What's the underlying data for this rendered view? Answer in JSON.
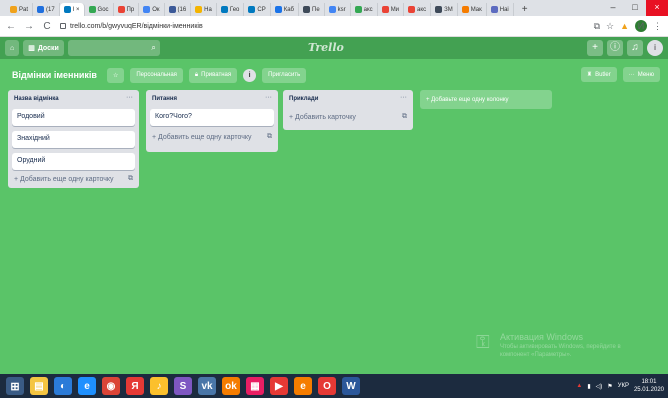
{
  "browser": {
    "tabs": [
      {
        "label": "Pat",
        "color": "#f0a21b"
      },
      {
        "label": "(17",
        "color": "#1f6fde"
      },
      {
        "label": "I ×",
        "color": "#0079bf",
        "active": true
      },
      {
        "label": "Goc",
        "color": "#34a853"
      },
      {
        "label": "Пр",
        "color": "#ea4335"
      },
      {
        "label": "Ок",
        "color": "#4285f4"
      },
      {
        "label": "(16",
        "color": "#3b5998"
      },
      {
        "label": "Ha",
        "color": "#f4b400"
      },
      {
        "label": "Гео",
        "color": "#0079bf"
      },
      {
        "label": "СР",
        "color": "#0079bf"
      },
      {
        "label": "Каб",
        "color": "#1a73e8"
      },
      {
        "label": "Пе",
        "color": "#3e4a59"
      },
      {
        "label": "ksr",
        "color": "#4285f4"
      },
      {
        "label": "акс",
        "color": "#34a853"
      },
      {
        "label": "Ми",
        "color": "#ea4335"
      },
      {
        "label": "акс",
        "color": "#ea4335"
      },
      {
        "label": "ЗМ",
        "color": "#3e4a59"
      },
      {
        "label": "Мак",
        "color": "#f57c00"
      },
      {
        "label": "Наі",
        "color": "#5c6bc0"
      }
    ],
    "new_tab": "+",
    "window_controls": {
      "minimize": "–",
      "maximize": "□",
      "close": "×"
    },
    "url": "trello.com/b/gwyvuqER/відмінки-іменників",
    "profile_initial": "И"
  },
  "header": {
    "boards_label": "Доски",
    "logo": "Trello"
  },
  "board": {
    "title": "Відмінки іменників",
    "personal_label": "Персональная",
    "private_label": "Приватная",
    "member_badge": "i",
    "invite_label": "Пригласить",
    "butler_label": "Butler",
    "menu_label": "Меню"
  },
  "lists": [
    {
      "title": "Назва відмінка",
      "cards": [
        "Родовий",
        "Знахідний",
        "Орудний"
      ],
      "add_label": "Добавить еще одну карточку"
    },
    {
      "title": "Питання",
      "cards": [
        "Кого?Чого?"
      ],
      "add_label": "Добавить еще одну карточку"
    },
    {
      "title": "Приклади",
      "cards": [],
      "add_label": "Добавить карточку"
    }
  ],
  "add_list_label": "Добавьте еще одну колонку",
  "watermark": {
    "title": "Активация Windows",
    "line1": "Чтобы активировать Windows, перейдите в",
    "line2": "компонент «Параметры»."
  },
  "taskbar": {
    "apps": [
      {
        "name": "file-explorer",
        "color": "#f4c542",
        "glyph": "▤"
      },
      {
        "name": "browser-a",
        "color": "#2b7bd8",
        "glyph": "◐"
      },
      {
        "name": "edge",
        "color": "#1e90ff",
        "glyph": "e"
      },
      {
        "name": "chrome",
        "color": "#db4437",
        "glyph": "◉"
      },
      {
        "name": "yandex",
        "color": "#e53935",
        "glyph": "Я"
      },
      {
        "name": "photos",
        "color": "#fbc02d",
        "glyph": "♪"
      },
      {
        "name": "skype",
        "color": "#7e57c2",
        "glyph": "S"
      },
      {
        "name": "vk",
        "color": "#4a76a8",
        "glyph": "vk"
      },
      {
        "name": "ok",
        "color": "#f57c00",
        "glyph": "ok"
      },
      {
        "name": "store",
        "color": "#e91e63",
        "glyph": "▦"
      },
      {
        "name": "youtube",
        "color": "#e53935",
        "glyph": "▶"
      },
      {
        "name": "ie",
        "color": "#f57c00",
        "glyph": "e"
      },
      {
        "name": "opera",
        "color": "#e53935",
        "glyph": "O"
      },
      {
        "name": "word",
        "color": "#2b579a",
        "glyph": "W"
      }
    ],
    "lang": "УКР",
    "time": "18:01",
    "date": "25.01.2020"
  }
}
